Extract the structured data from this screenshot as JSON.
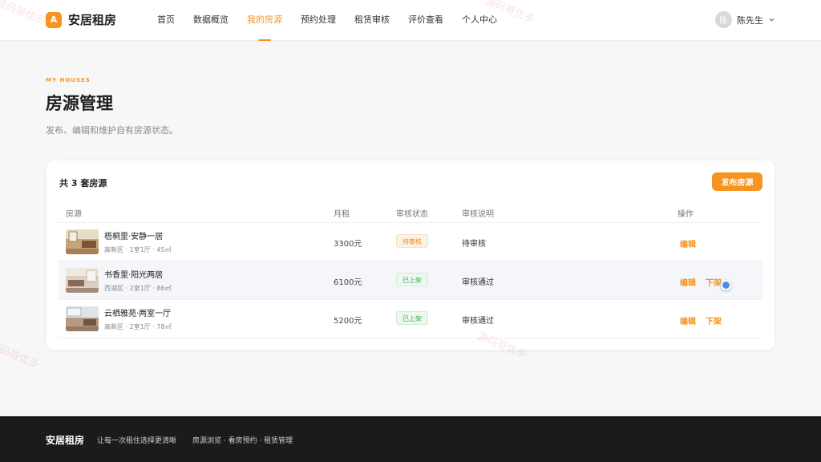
{
  "header": {
    "logo_badge": "A",
    "logo_text": "安居租房",
    "nav": [
      "首页",
      "数据概览",
      "我的房源",
      "预约处理",
      "租赁审核",
      "评价查看",
      "个人中心"
    ],
    "active_nav": "我的房源",
    "user_avatar": "陈",
    "user_name": "陈先生"
  },
  "page": {
    "eyebrow": "MY HOUSES",
    "title": "房源管理",
    "description": "发布、编辑和维护自有房源状态。"
  },
  "card": {
    "count_text": "共 3 套房源",
    "publish_label": "发布房源",
    "columns": [
      "房源",
      "月租",
      "审核状态",
      "审核说明",
      "操作"
    ],
    "rows": [
      {
        "name": "梧桐里·安静一居",
        "meta": "高新区 · 1室1厅 · 45㎡",
        "rent": "3300元",
        "status": "待审核",
        "note": "待审核",
        "actions": [
          "编辑"
        ]
      },
      {
        "name": "书香里·阳光两居",
        "meta": "西湖区 · 2室1厅 · 86㎡",
        "rent": "6100元",
        "status": "已上架",
        "note": "审核通过",
        "actions": [
          "编辑",
          "下架"
        ]
      },
      {
        "name": "云栖雅苑·两室一厅",
        "meta": "高新区 · 2室1厅 · 78㎡",
        "rent": "5200元",
        "status": "已上架",
        "note": "审核通过",
        "actions": [
          "编辑",
          "下架"
        ]
      }
    ]
  },
  "footer": {
    "logo": "安居租房",
    "slogan": "让每一次租住选择更清晰",
    "links": "房源浏览 · 看房预约 · 租赁管理"
  },
  "watermark": "源码哥优多",
  "colors": {
    "accent": "#f7931e",
    "pending": "#e08a2b",
    "online": "#3fae5a",
    "footer": "#1b1b1b"
  },
  "icons": {
    "user_menu": "chevron-down-icon",
    "cursor": "cursor-dot"
  }
}
